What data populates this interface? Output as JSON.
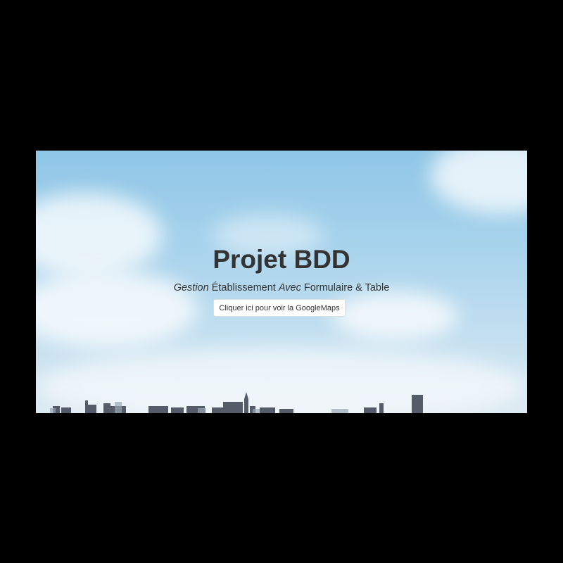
{
  "hero": {
    "title": "Projet BDD",
    "subtitle": {
      "part1": "Gestion",
      "part2": " Établissement ",
      "part3": "Avec",
      "part4": " Formulaire & Table"
    },
    "button_label": "Cliquer ici pour voir la GoogleMaps"
  },
  "colors": {
    "page_background": "#000000",
    "sky": "#a6d2ec",
    "text": "#333333",
    "button_background": "#ffffff"
  }
}
